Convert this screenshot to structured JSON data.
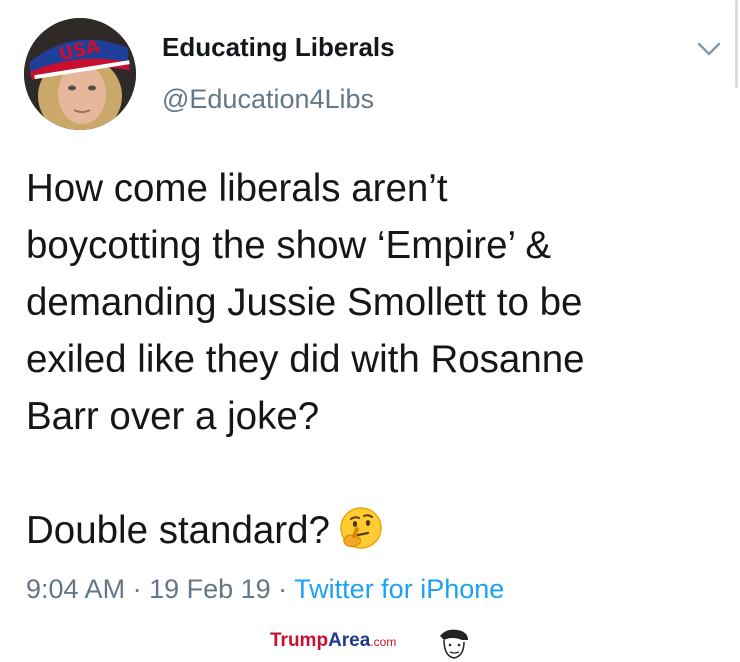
{
  "tweet": {
    "display_name": "Educating Liberals",
    "handle": "@Education4Libs",
    "avatar_hat_text": "USA",
    "body_lines": [
      "How come liberals aren’t",
      "boycotting the show ‘Empire’ &",
      "demanding Jussie Smollett to be",
      "exiled like they did with Rosanne",
      "Barr over a joke?"
    ],
    "closing_line": "Double standard?",
    "emoji": "thinking-face",
    "time": "9:04 AM",
    "separator": " · ",
    "date": "19 Feb 19",
    "source": "Twitter for iPhone"
  },
  "watermark": {
    "part1": "Trump",
    "part2": "Area",
    "part3": ".com"
  },
  "colors": {
    "text": "#14171a",
    "secondary": "#657786",
    "link": "#1da1f2"
  }
}
